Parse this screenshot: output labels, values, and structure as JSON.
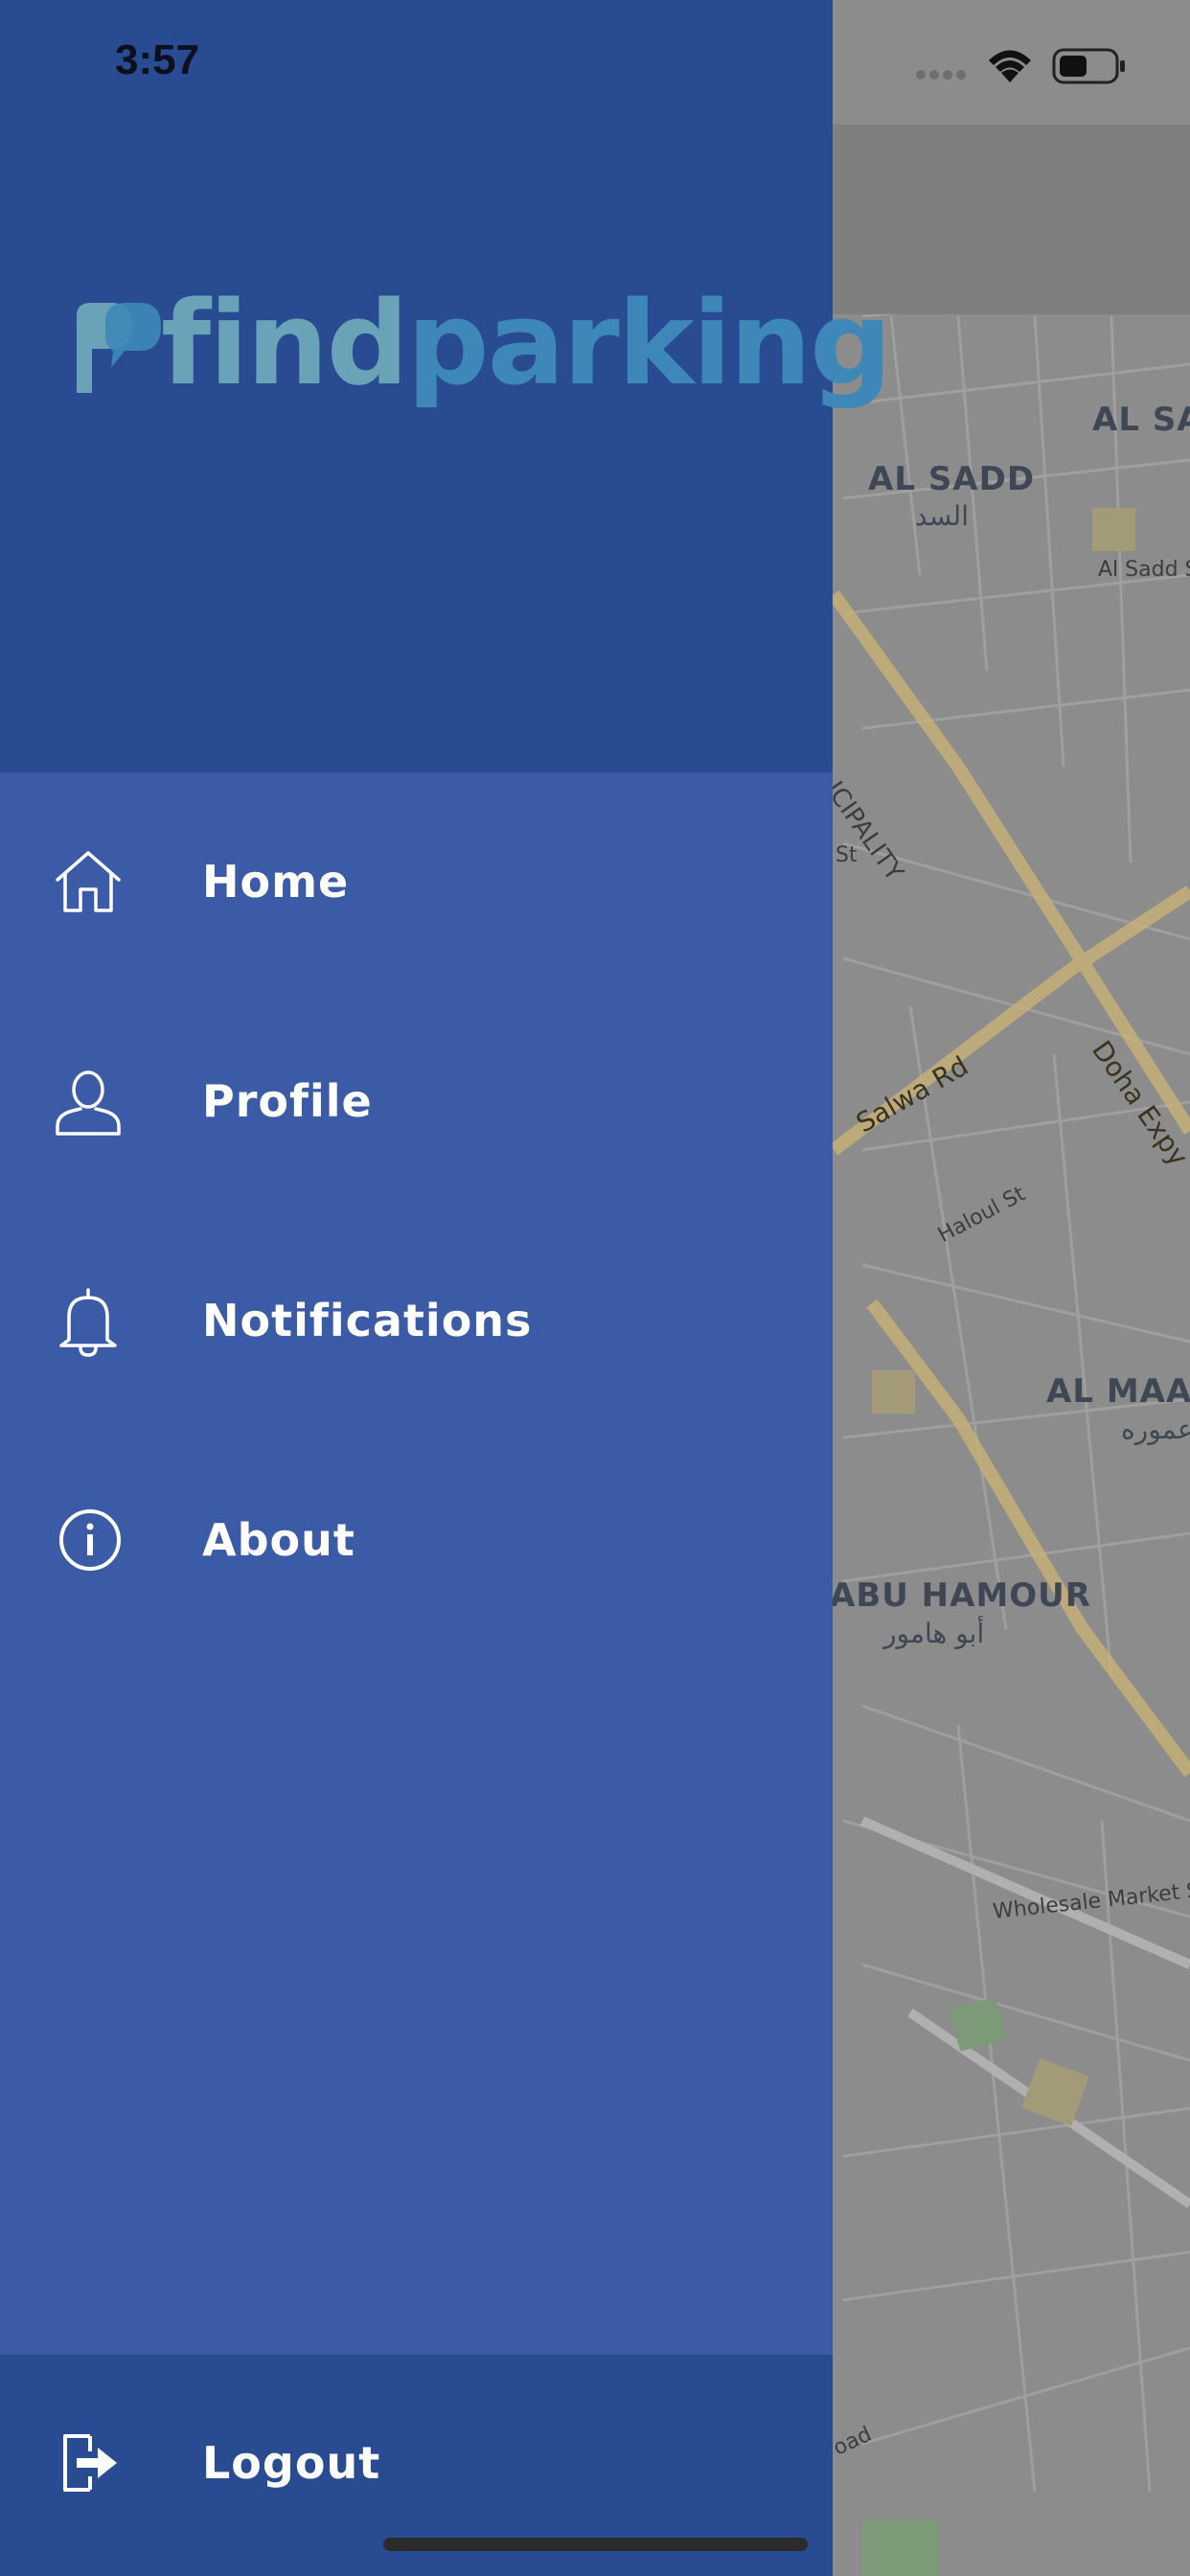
{
  "status_bar": {
    "time": "3:57"
  },
  "brand": {
    "name_part1": "find",
    "name_part2": "parking"
  },
  "menu": {
    "items": [
      {
        "label": "Home",
        "icon": "home-icon"
      },
      {
        "label": "Profile",
        "icon": "user-icon"
      },
      {
        "label": "Notifications",
        "icon": "bell-icon"
      },
      {
        "label": "About",
        "icon": "info-icon"
      }
    ],
    "logout": {
      "label": "Logout",
      "icon": "logout-icon"
    }
  },
  "map": {
    "areas": [
      {
        "en": "AL SADD",
        "ar": "السد"
      },
      {
        "en": "AL SA"
      },
      {
        "en": "AL MAAI",
        "ar": "عموره"
      },
      {
        "en": "ABU HAMOUR",
        "ar": "أبو هامور"
      }
    ],
    "streets": {
      "al_sadd_st": "Al Sadd S",
      "municipality": "ICIPALITY",
      "st": "St",
      "salwa_rd": "Salwa Rd",
      "doha_expy": "Doha Expy",
      "haloul_st": "Haloul St",
      "wholesale": "Wholesale Market St",
      "oad": "oad"
    }
  },
  "colors": {
    "drawer_header": "#284b91",
    "drawer_body": "#3b5ba7",
    "logo_primary": "#6aa3b7",
    "logo_secondary": "#3d88b9"
  }
}
